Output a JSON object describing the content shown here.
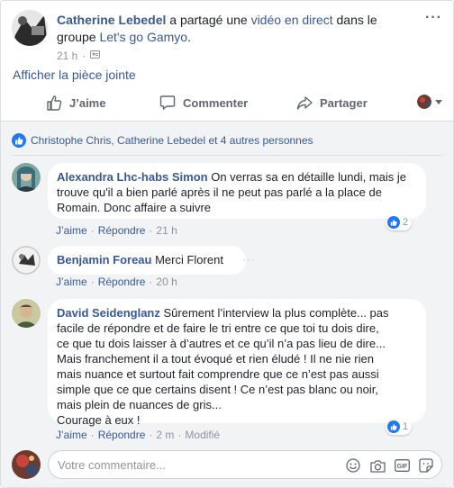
{
  "post": {
    "author": "Catherine Lebedel",
    "text_shared": "a partagé une",
    "video_link": "vidéo en direct",
    "text_in_group": "dans le groupe",
    "group": "Let's go Gamyo",
    "trailing": ".",
    "time": "21 h",
    "more": "···",
    "attachment_link": "Afficher la pièce jointe"
  },
  "actions": {
    "like": "J’aime",
    "comment": "Commenter",
    "share": "Partager"
  },
  "likes_summary": "Christophe Chris, Catherine Lebedel et 4 autres personnes",
  "comments": [
    {
      "author": "Alexandra Lhc-habs Simon",
      "text": "On verras sa en détaille lundi, mais je trouve qu'il a bien parlé après il ne peut pas parlé a la place de Romain. Donc affaire a suivre",
      "like_label": "J’aime",
      "reply_label": "Répondre",
      "time": "21 h",
      "reactions": "2"
    },
    {
      "author": "Benjamin Foreau",
      "text": "Merci Florent",
      "like_label": "J’aime",
      "reply_label": "Répondre",
      "time": "20 h",
      "more": "···"
    },
    {
      "author": "David Seidenglanz",
      "text_lines": [
        "Sûrement l’interview la plus complète... pas",
        "facile de répondre et de faire le tri entre ce que toi tu dois dire,",
        "ce que tu dois laisser à d’autres et ce qu’il n’a pas lieu de dire...",
        "Mais franchement il a tout évoqué et rien éludé ! Il ne nie rien",
        "mais nuance et surtout fait comprendre que ce n’est pas aussi",
        "simple que ce que certains disent ! Ce n’est pas blanc ou noir,",
        "mais plein de nuances de gris...",
        "Courage à eux !"
      ],
      "like_label": "J’aime",
      "reply_label": "Répondre",
      "time": "2 m",
      "edited": "Modifié",
      "reactions": "1"
    }
  ],
  "composer": {
    "placeholder": "Votre commentaire..."
  },
  "colors": {
    "link": "#385898",
    "meta": "#90949c",
    "like_blue": "#2078f4",
    "comment_bg": "#f2f3f5"
  }
}
